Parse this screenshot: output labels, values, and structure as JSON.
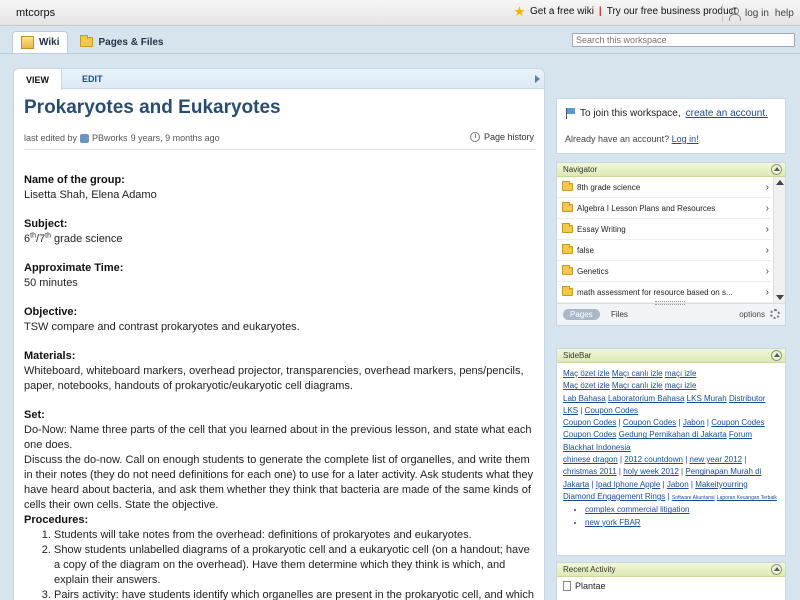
{
  "topbar": {
    "brand": "mtcorps",
    "promo_wiki": "Get a free wiki",
    "promo_sep": "|",
    "promo_business": "Try our free business product",
    "login": "log in",
    "help": "help"
  },
  "nav": {
    "tab_wiki": "Wiki",
    "tab_pages": "Pages & Files",
    "search_placeholder": "Search this workspace"
  },
  "page": {
    "tab_view": "VIEW",
    "tab_edit": "EDIT",
    "title": "Prokaryotes and Eukaryotes",
    "meta_prefix": "last edited by",
    "meta_author": "PBworks",
    "meta_time": "9 years, 9 months ago",
    "history": "Page history",
    "sections": {
      "group_h": "Name of the group:",
      "group_v": "Lisetta Shah, Elena Adamo",
      "subject_h": "Subject:",
      "subject_6": "6",
      "subject_th1": "th",
      "subject_slash": "/7",
      "subject_th2": "th",
      "subject_rest": " grade science",
      "time_h": "Approximate Time:",
      "time_v": "50 minutes",
      "objective_h": "Objective:",
      "objective_v": "TSW compare and contrast prokaryotes and eukaryotes.",
      "materials_h": "Materials:",
      "materials_v": "Whiteboard, whiteboard markers, overhead projector, transparencies, overhead markers, pens/pencils, paper, notebooks, handouts of prokaryotic/eukaryotic cell diagrams.",
      "set_h": "Set:",
      "set_p1": "Do-Now: Name three parts of the cell that you learned about in the previous lesson, and state what each one does.",
      "set_p2": "Discuss the do-now.  Call on enough students to generate the complete list of organelles, and write them in their notes (they do not need definitions for each one) to use for a later activity.  Ask students what they have heard about bacteria, and ask them whether they think that bacteria are made of the same kinds of cells their own cells.  State the objective.",
      "procedures_h": "Procedures:",
      "proc_1": "Students will take notes from the overhead: definitions of prokaryotes and eukaryotes.",
      "proc_2": "Show students unlabelled diagrams of a prokaryotic cell and a eukaryotic cell (on a handout; have a copy of the diagram on the overhead).  Have them determine which they think is which, and explain their answers.",
      "proc_3": "Pairs activity: have students identify which organelles are present in the prokaryotic cell, and which are"
    }
  },
  "join": {
    "text": "To join this workspace,",
    "link": "create an account.",
    "account_q": "Already have an account?",
    "login_link": "Log in!"
  },
  "navigator": {
    "title": "Navigator",
    "items": [
      "8th grade science",
      "Algebra I Lesson Plans and Resources",
      "Essay Writing",
      "false",
      "Genetics",
      "math assessment for resource based on s..."
    ],
    "pages": "Pages",
    "files": "Files",
    "options": "options"
  },
  "sidebar": {
    "title": "SideBar",
    "l1": "Maç özet izle",
    "l2": "Maçı canlı izle",
    "l3": "maçı izle",
    "l4": "Maç özet izle",
    "l5": "Maçı canlı izle",
    "l6": "maçı izle",
    "l7": "Lab Bahasa",
    "l8": "Laboratorium Bahasa",
    "l9": "LKS Murah",
    "l10": "Distributor LKS",
    "l11": "Coupon Codes",
    "l12": "Coupon Codes",
    "l13": "Coupon Codes",
    "l14": "Jabon",
    "l15": "Coupon Codes",
    "l16": "Coupon Codes",
    "l17": "Gedung Pernikahan di Jakarta",
    "l18": "Forum Blackhat Indonesia",
    "l19": "chinese dragon",
    "l20": "2012 countdown",
    "l21": "new year 2012",
    "l22": "christmas 2011",
    "l23": "holy week 2012",
    "l24": "Penginapan Murah di Jakarta",
    "l25": "Ipad Iphone Apple",
    "l26": "Jabon",
    "l27": "Makeityourring Diamond Engagement Rings",
    "l28": "Software Akuntansi",
    "l29": "Laporan Keuangan Terbaik",
    "bullet1": "complex commercial litigation",
    "bullet2": "new york FBAR",
    "sep": "|"
  },
  "activity": {
    "title": "Recent Activity",
    "item1": "Plantae"
  }
}
